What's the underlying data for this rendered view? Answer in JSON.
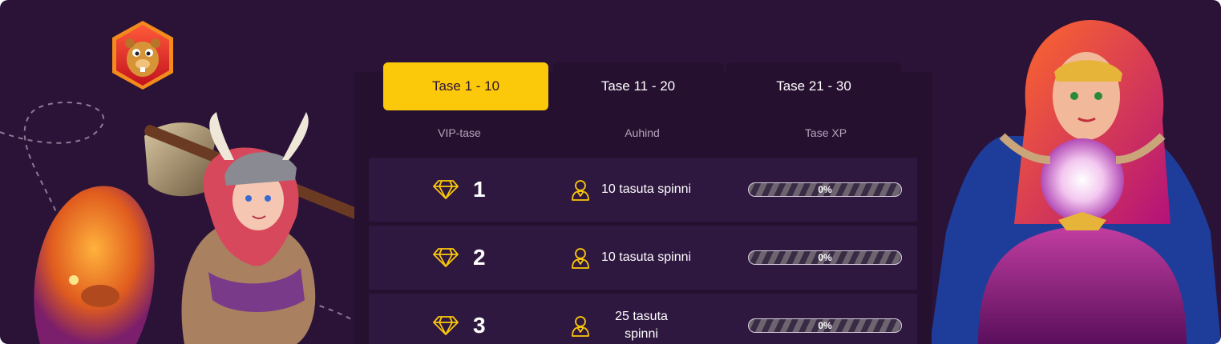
{
  "tabs": [
    {
      "label": "Tase 1 - 10",
      "active": true
    },
    {
      "label": "Tase 11 - 20",
      "active": false
    },
    {
      "label": "Tase 21 - 30",
      "active": false
    }
  ],
  "columns": {
    "level": "VIP-tase",
    "reward": "Auhind",
    "xp": "Tase XP"
  },
  "rows": [
    {
      "level": "1",
      "reward": "10 tasuta spinni",
      "xp_text": "0%",
      "xp_progress": 0
    },
    {
      "level": "2",
      "reward": "10 tasuta spinni",
      "xp_text": "0%",
      "xp_progress": 0
    },
    {
      "level": "3",
      "reward": "25 tasuta spinni",
      "xp_text": "0%",
      "xp_progress": 0
    }
  ],
  "icons": {
    "level_icon": "diamond-icon",
    "reward_icon": "user-badge-icon",
    "logo": "beaver-logo-icon"
  },
  "colors": {
    "background": "#2a1337",
    "accent": "#fcc80a",
    "row": "#2f1840"
  }
}
